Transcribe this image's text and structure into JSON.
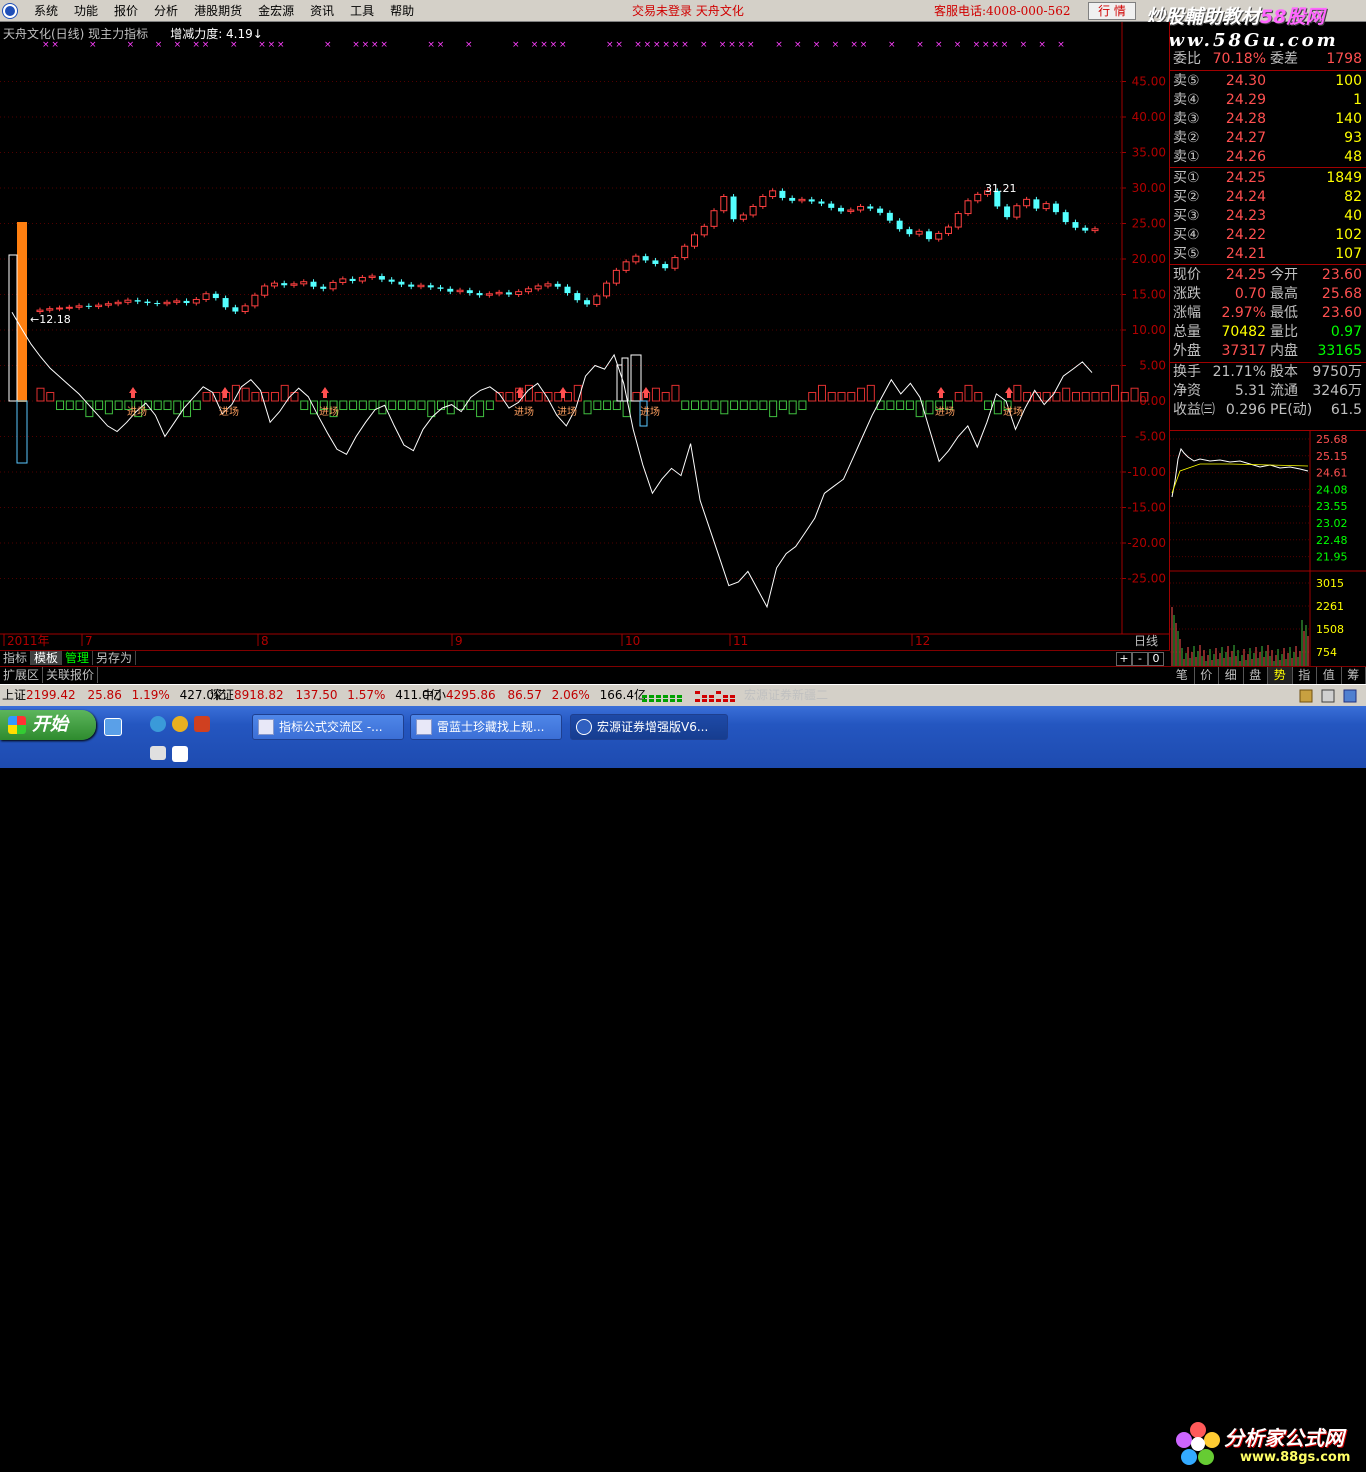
{
  "menu": {
    "items": [
      "系统",
      "功能",
      "报价",
      "分析",
      "港股期货",
      "金宏源",
      "资讯",
      "工具",
      "帮助"
    ],
    "status": "交易未登录  天舟文化",
    "hotline": "客服电话:4008-000-562",
    "hotline_button": "行 情"
  },
  "watermark": {
    "line1": "炒股輔助教材",
    "line1b": "58股网",
    "line2": "www.58Gu.com"
  },
  "chart_title": {
    "stock": "天舟文化(日线) 现主力指标",
    "indicator": "增减力度: 4.19↓"
  },
  "chart_data": {
    "type": "line",
    "y_axis_ticks": [
      "45.00",
      "40.00",
      "35.00",
      "30.00",
      "25.00",
      "20.00",
      "15.00",
      "10.00",
      "5.00",
      "0.00",
      "-5.00",
      "-10.00",
      "-15.00",
      "-20.00",
      "-25.00"
    ],
    "x_axis_labels": [
      "2011年",
      "7",
      "8",
      "9",
      "10",
      "11",
      "12"
    ],
    "annotations": {
      "max_price": "31.21",
      "min_price": "12.18"
    },
    "tag_label": "进场",
    "period_label": "日线",
    "candles_close": [
      12.8,
      13.0,
      13.1,
      13.2,
      13.4,
      13.3,
      13.5,
      13.7,
      13.9,
      14.2,
      14.0,
      13.8,
      13.7,
      13.9,
      14.1,
      13.8,
      14.3,
      15.1,
      14.5,
      13.2,
      12.6,
      13.4,
      14.9,
      16.2,
      16.6,
      16.3,
      16.5,
      16.8,
      16.1,
      15.8,
      16.7,
      17.2,
      16.9,
      17.4,
      17.6,
      17.1,
      16.8,
      16.4,
      16.1,
      16.3,
      16.0,
      15.8,
      15.4,
      15.6,
      15.2,
      14.9,
      15.1,
      15.3,
      15.0,
      15.4,
      15.8,
      16.2,
      16.5,
      16.1,
      15.2,
      14.2,
      13.6,
      14.8,
      16.6,
      18.4,
      19.6,
      20.4,
      19.8,
      19.3,
      18.7,
      20.2,
      21.8,
      23.4,
      24.6,
      26.8,
      28.8,
      25.6,
      26.2,
      27.4,
      28.8,
      29.6,
      28.6,
      28.2,
      28.4,
      28.1,
      27.8,
      27.2,
      26.7,
      26.9,
      27.4,
      27.1,
      26.5,
      25.4,
      24.2,
      23.5,
      23.9,
      22.8,
      23.6,
      24.5,
      26.4,
      28.2,
      29.1,
      29.6,
      27.4,
      25.9,
      27.5,
      28.4,
      27.1,
      27.8,
      26.6,
      25.2,
      24.4,
      24.0,
      24.25
    ],
    "indicator_line": [
      12.5,
      10.2,
      8.0,
      6.2,
      4.6,
      3.4,
      2.2,
      1.0,
      -0.5,
      -2.0,
      -3.5,
      -4.3,
      -3.0,
      -1.5,
      -0.3,
      -2.0,
      -5.0,
      -3.0,
      -1.0,
      0.5,
      2.0,
      1.2,
      -1.8,
      -0.5,
      2.0,
      3.0,
      1.5,
      -3.0,
      -1.5,
      0.5,
      1.8,
      0.6,
      -2.0,
      -4.5,
      -6.8,
      -7.5,
      -5.0,
      -3.0,
      -1.2,
      -0.6,
      -3.5,
      -6.2,
      -7.0,
      -4.0,
      -2.2,
      -1.0,
      -0.5,
      -1.5,
      0.5,
      1.5,
      2.0,
      1.0,
      -1.0,
      -0.2,
      1.5,
      2.5,
      0.5,
      -2.0,
      -3.5,
      -1.0,
      3.5,
      5.0,
      4.5,
      6.5,
      2.5,
      -4.0,
      -9.0,
      -13.0,
      -11.0,
      -9.5,
      -10.5,
      -6.0,
      -14.0,
      -18.0,
      -22.0,
      -26.0,
      -25.5,
      -24.0,
      -26.5,
      -29.0,
      -23.5,
      -21.5,
      -20.5,
      -18.5,
      -16.5,
      -13.0,
      -12.0,
      -11.0,
      -8.0,
      -5.0,
      -2.0,
      0.5,
      3.0,
      1.0,
      2.5,
      0.5,
      -4.0,
      -8.5,
      -7.0,
      -5.0,
      -3.5,
      -6.5,
      -3.0,
      1.0,
      0.0,
      -4.0,
      -1.0,
      1.5,
      -0.5,
      1.0,
      3.5,
      4.5,
      5.5,
      4.0
    ],
    "grid": true
  },
  "quote": {
    "top_partial": {
      "l": "委比",
      "p": "70.18%",
      "l2": "委差",
      "v": "1798"
    },
    "sell": [
      {
        "label": "卖⑤",
        "price": "24.30",
        "vol": "100"
      },
      {
        "label": "卖④",
        "price": "24.29",
        "vol": "1"
      },
      {
        "label": "卖③",
        "price": "24.28",
        "vol": "140"
      },
      {
        "label": "卖②",
        "price": "24.27",
        "vol": "93"
      },
      {
        "label": "卖①",
        "price": "24.26",
        "vol": "48"
      }
    ],
    "buy": [
      {
        "label": "买①",
        "price": "24.25",
        "vol": "1849"
      },
      {
        "label": "买②",
        "price": "24.24",
        "vol": "82"
      },
      {
        "label": "买③",
        "price": "24.23",
        "vol": "40"
      },
      {
        "label": "买④",
        "price": "24.22",
        "vol": "102"
      },
      {
        "label": "买⑤",
        "price": "24.21",
        "vol": "107"
      }
    ],
    "stats": [
      {
        "l": "现价",
        "p": "24.25",
        "l2": "今开",
        "v": "23.60",
        "pc": "#ff5050",
        "vc": "#ff5050"
      },
      {
        "l": "涨跌",
        "p": "0.70",
        "l2": "最高",
        "v": "25.68",
        "pc": "#ff5050",
        "vc": "#ff5050"
      },
      {
        "l": "涨幅",
        "p": "2.97%",
        "l2": "最低",
        "v": "23.60",
        "pc": "#ff5050",
        "vc": "#ff5050"
      },
      {
        "l": "总量",
        "p": "70482",
        "l2": "量比",
        "v": "0.97",
        "pc": "#ffff00",
        "vc": "#00ff00"
      },
      {
        "l": "外盘",
        "p": "37317",
        "l2": "内盘",
        "v": "33165",
        "pc": "#ff5050",
        "vc": "#00ff00"
      }
    ],
    "stats2": [
      {
        "l": "换手",
        "p": "21.71%",
        "l2": "股本",
        "v": "9750万"
      },
      {
        "l": "净资",
        "p": "5.31",
        "l2": "流通",
        "v": "3246万"
      },
      {
        "l": "收益㈢",
        "p": "0.296",
        "l2": "PE(动)",
        "v": "61.5"
      }
    ]
  },
  "minichart": {
    "price_ticks": [
      "25.68",
      "25.15",
      "24.61",
      "24.08",
      "23.55",
      "23.02",
      "22.48",
      "21.95"
    ],
    "vol_ticks": [
      "3015",
      "2261",
      "1508",
      "754"
    ]
  },
  "tabs": [
    "指标",
    "模板",
    "管理",
    "另存为"
  ],
  "tab_controls": [
    "+",
    "-",
    "0"
  ],
  "ext_tabs": [
    "扩展区",
    "关联报价"
  ],
  "side_tabs": [
    "笔",
    "价",
    "细",
    "盘",
    "势",
    "指",
    "值",
    "筹"
  ],
  "indexbar": {
    "sh": {
      "name": "上证",
      "val": "2199.42",
      "chg": "25.86",
      "pct": "1.19%",
      "amt": "427.0亿"
    },
    "sz": {
      "name": "深证",
      "val": "8918.82",
      "chg": "137.50",
      "pct": "1.57%",
      "amt": "411.0亿"
    },
    "zx": {
      "name": "中小",
      "val": "4295.86",
      "chg": "86.57",
      "pct": "2.06%",
      "amt": "166.4亿"
    },
    "broker": "宏源证券新疆二"
  },
  "taskbar": {
    "start": "开始",
    "tasks": [
      "指标公式交流区 -...",
      "雷蓝士珍藏找上规...",
      "宏源证券增强版V6..."
    ],
    "brand1": "分析家公式网",
    "brand2": "www.88gs.com"
  }
}
